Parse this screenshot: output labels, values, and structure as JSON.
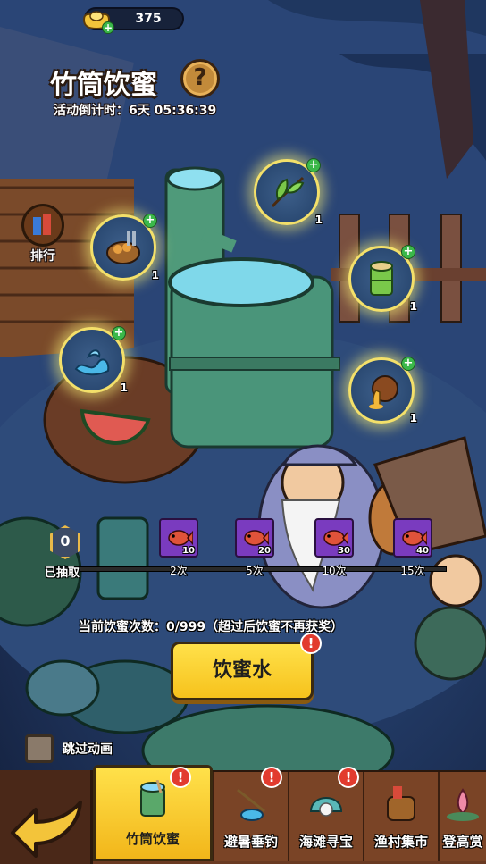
{
  "currency": {
    "amount": "375",
    "plus": "+"
  },
  "event": {
    "title": "竹筒饮蜜",
    "help": "?",
    "countdown": "活动倒计时：6天 05:36:39"
  },
  "rank": {
    "label": "排行"
  },
  "ingredients": [
    {
      "name": "mushroom-bowl",
      "count": "1"
    },
    {
      "name": "leaf",
      "count": "1"
    },
    {
      "name": "bamboo-segment",
      "count": "1"
    },
    {
      "name": "water-splash",
      "count": "1"
    },
    {
      "name": "honey-jar",
      "count": "1"
    }
  ],
  "progress": {
    "drawn_count": "0",
    "drawn_label": "已抽取",
    "milestones": [
      {
        "qty": "10",
        "label": "2次"
      },
      {
        "qty": "20",
        "label": "5次"
      },
      {
        "qty": "30",
        "label": "10次"
      },
      {
        "qty": "40",
        "label": "15次"
      }
    ]
  },
  "drink_count_text": "当前饮蜜次数：0/999（超过后饮蜜不再获奖）",
  "drink_button": "饮蜜水",
  "alert_mark": "!",
  "skip_label": "跳过动画",
  "tabs": [
    {
      "label": "竹筒饮蜜",
      "active": true
    },
    {
      "label": "避暑垂钓"
    },
    {
      "label": "海滩寻宝"
    },
    {
      "label": "渔村集市"
    },
    {
      "label": "登高赏"
    }
  ],
  "colors": {
    "accent": "#ffe14a",
    "glow": "#f3e06a",
    "plus": "#3bb84a",
    "alert": "#e23b2e"
  }
}
